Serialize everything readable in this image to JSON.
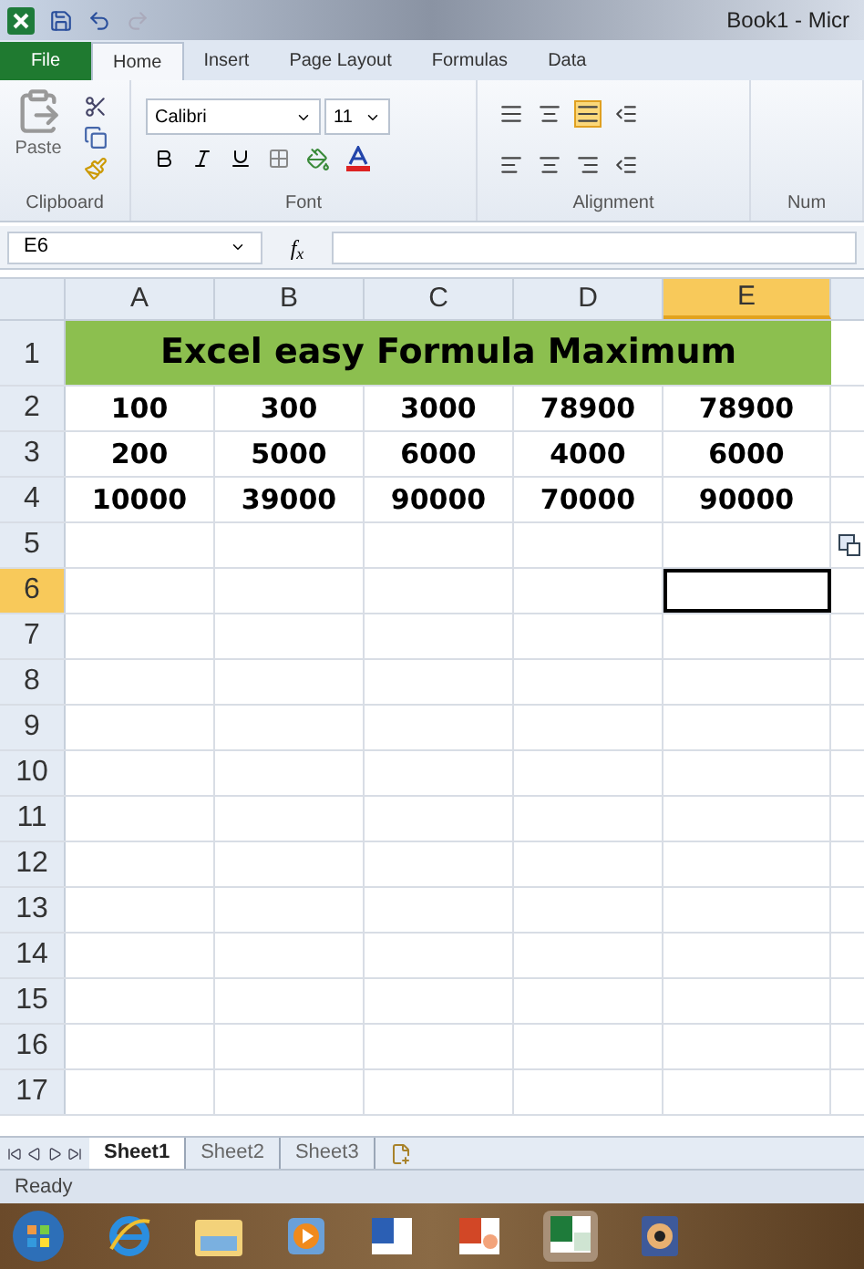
{
  "title_bar": {
    "title": "Book1 - Micr"
  },
  "ribbon_tabs": [
    {
      "label": "File",
      "kind": "file",
      "selected": false
    },
    {
      "label": "Home",
      "kind": "tab",
      "selected": true
    },
    {
      "label": "Insert",
      "kind": "tab",
      "selected": false
    },
    {
      "label": "Page Layout",
      "kind": "tab",
      "selected": false
    },
    {
      "label": "Formulas",
      "kind": "tab",
      "selected": false
    },
    {
      "label": "Data",
      "kind": "tab",
      "selected": false
    }
  ],
  "clipboard": {
    "paste_label": "Paste",
    "group_label": "Clipboard"
  },
  "font": {
    "font_name": "Calibri",
    "font_size": "11",
    "group_label": "Font"
  },
  "alignment": {
    "group_label": "Alignment"
  },
  "number": {
    "group_label": "Num"
  },
  "formula_bar": {
    "name_box": "E6",
    "fx": "f$_{x}$"
  },
  "columns": [
    {
      "label": "A",
      "selected": false
    },
    {
      "label": "B",
      "selected": false
    },
    {
      "label": "C",
      "selected": false
    },
    {
      "label": "D",
      "selected": false
    },
    {
      "label": "E",
      "selected": true
    }
  ],
  "title_row": {
    "header": "1",
    "text": "Excel easy Formula Maximum"
  },
  "rows": [
    {
      "header": "2",
      "selected": false,
      "cells": [
        "100",
        "300",
        "3000",
        "78900",
        "78900"
      ]
    },
    {
      "header": "3",
      "selected": false,
      "cells": [
        "200",
        "5000",
        "6000",
        "4000",
        "6000"
      ]
    },
    {
      "header": "4",
      "selected": false,
      "cells": [
        "10000",
        "39000",
        "90000",
        "70000",
        "90000"
      ]
    },
    {
      "header": "5",
      "selected": false
    },
    {
      "header": "6",
      "selected": true
    },
    {
      "header": "7",
      "selected": false
    },
    {
      "header": "8",
      "selected": false
    },
    {
      "header": "9",
      "selected": false
    },
    {
      "header": "10",
      "selected": false
    },
    {
      "header": "11",
      "selected": false
    },
    {
      "header": "12",
      "selected": false
    },
    {
      "header": "13",
      "selected": false
    },
    {
      "header": "14",
      "selected": false
    },
    {
      "header": "15",
      "selected": false
    },
    {
      "header": "16",
      "selected": false
    },
    {
      "header": "17",
      "selected": false
    }
  ],
  "sheet_tabs": [
    {
      "label": "Sheet1",
      "selected": true
    },
    {
      "label": "Sheet2",
      "selected": false
    },
    {
      "label": "Sheet3",
      "selected": false
    }
  ],
  "status_bar": {
    "text": "Ready"
  }
}
